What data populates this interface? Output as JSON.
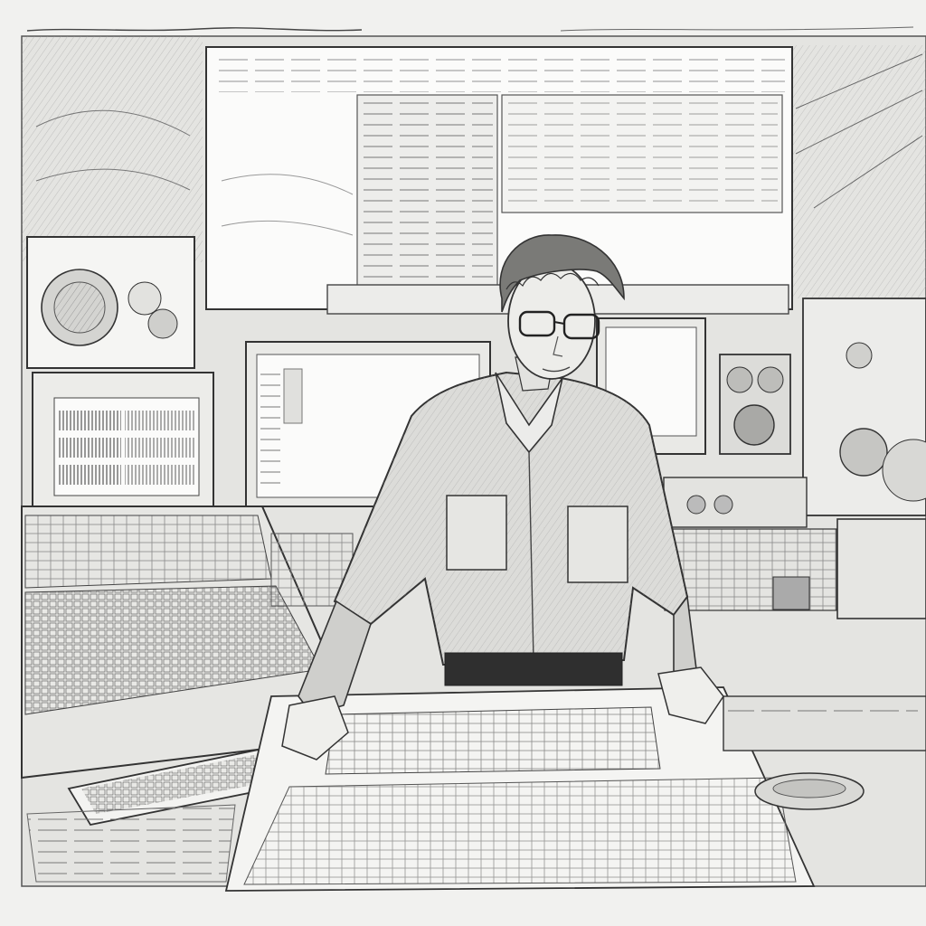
{
  "image": {
    "style": "pencil-sketch",
    "palette": {
      "paper": "#f1f1ef",
      "line": "#3a3a3a",
      "shade": "#9a9a9a",
      "light": "#d9d9d6",
      "screen": "#fbfbfa"
    },
    "subject": {
      "figure": "man-at-console",
      "features": [
        "curly-hair",
        "glasses",
        "rolled-sleeve-shirt",
        "dark-belt"
      ]
    },
    "objects": [
      "projection-screen",
      "crt-monitor",
      "waveform-monitor",
      "mixing-console",
      "keyboard",
      "speakers",
      "rack-equipment",
      "schematic-sheets",
      "reel-disc"
    ]
  }
}
